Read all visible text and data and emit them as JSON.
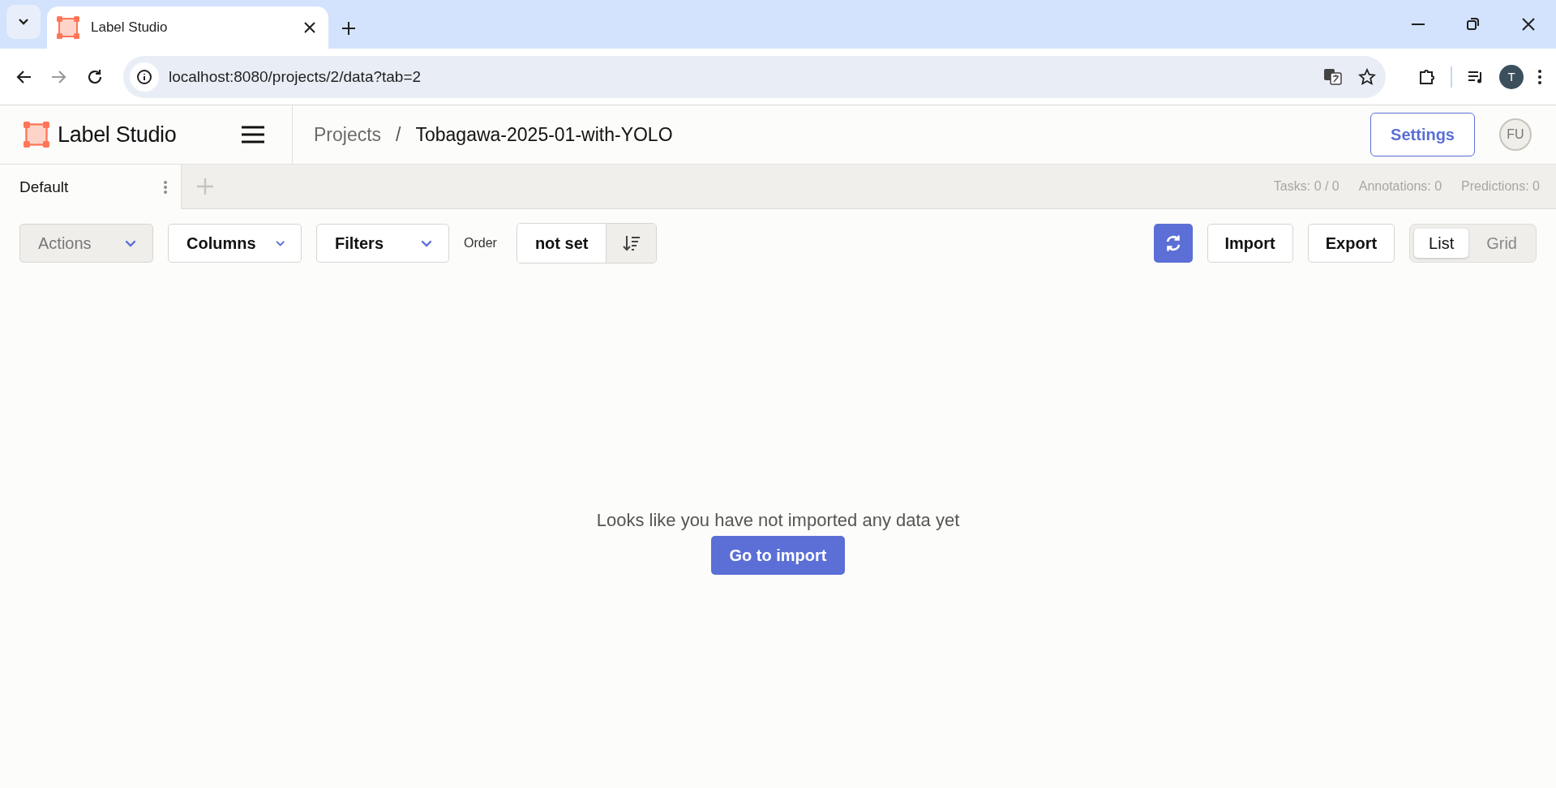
{
  "browser": {
    "tab_title": "Label Studio",
    "url": "localhost:8080/projects/2/data?tab=2",
    "avatar": "T"
  },
  "header": {
    "logo": "Label Studio",
    "breadcrumb": [
      {
        "label": "Projects",
        "kind": "link"
      },
      {
        "label": "Tobagawa-2025-01-with-YOLO",
        "kind": "current"
      }
    ],
    "separator": "/",
    "settings": "Settings",
    "user": "FU"
  },
  "views": {
    "tabs": [
      {
        "label": "Default",
        "selected": true
      }
    ],
    "stats": [
      "Tasks: 0 / 0",
      "Annotations: 0",
      "Predictions: 0"
    ]
  },
  "toolbar": {
    "actions": {
      "label": "Actions",
      "disabled": true
    },
    "columns": "Columns",
    "filters": "Filters",
    "order_label": "Order",
    "order_value": "not set",
    "import": "Import",
    "export": "Export",
    "view_mode": [
      {
        "label": "List",
        "selected": true
      },
      {
        "label": "Grid",
        "selected": false
      }
    ]
  },
  "empty": {
    "message": "Looks like you have not imported any data yet",
    "button": "Go to import"
  }
}
